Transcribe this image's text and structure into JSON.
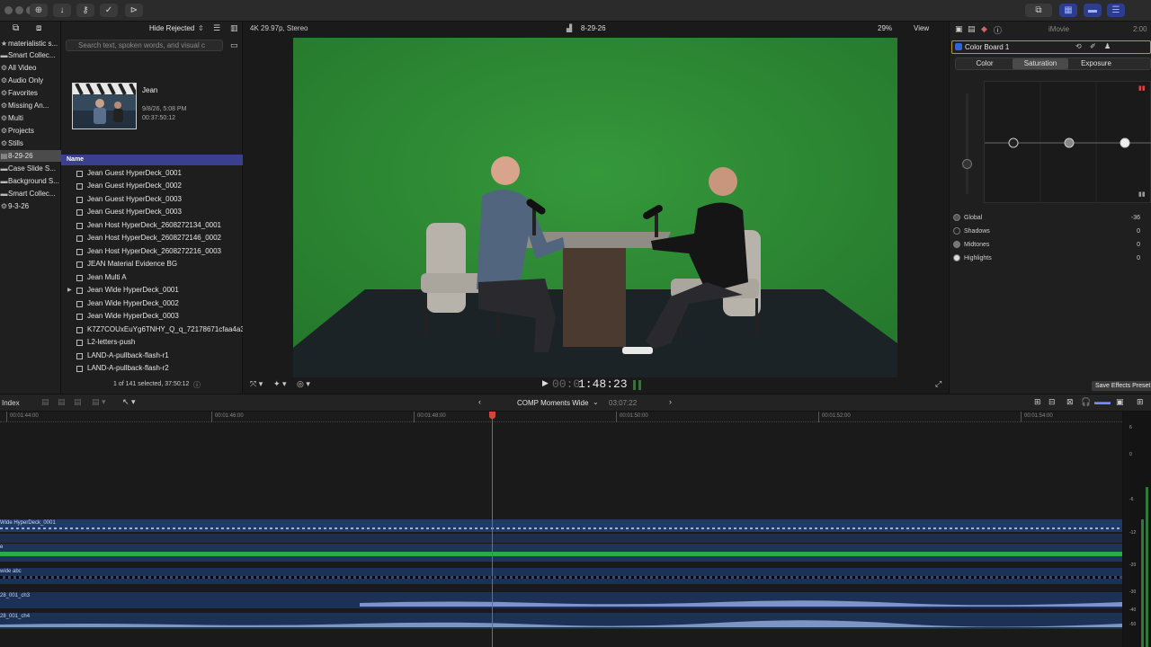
{
  "toolbar": {
    "icons": [
      "import-icon",
      "download-icon",
      "keyword-icon",
      "checkmark-icon",
      "tag-icon"
    ]
  },
  "sidebar": {
    "items": [
      {
        "label": "materialistic s...",
        "icon": "star"
      },
      {
        "label": "Smart Collec...",
        "icon": "folder"
      },
      {
        "label": "All Video",
        "icon": "gear"
      },
      {
        "label": "Audio Only",
        "icon": "gear"
      },
      {
        "label": "Favorites",
        "icon": "gear"
      },
      {
        "label": "Missing An...",
        "icon": "gear"
      },
      {
        "label": "Multi",
        "icon": "gear"
      },
      {
        "label": "Projects",
        "icon": "gear"
      },
      {
        "label": "Stills",
        "icon": "gear"
      },
      {
        "label": "8-29-26",
        "icon": "event",
        "selected": true
      },
      {
        "label": "Case Slide S...",
        "icon": "folder"
      },
      {
        "label": "Background S...",
        "icon": "folder"
      },
      {
        "label": "Smart Collec...",
        "icon": "folder"
      },
      {
        "label": "9-3-26",
        "icon": "event"
      }
    ]
  },
  "browser": {
    "filter": "Hide Rejected",
    "search_placeholder": "Search text, spoken words, and visual c",
    "clip": {
      "name": "Jean",
      "date": "9/8/26, 5:08 PM",
      "duration": "00:37:50:12"
    },
    "list_header": "Name",
    "rows": [
      {
        "name": "Jean Guest HyperDeck_0001"
      },
      {
        "name": "Jean Guest HyperDeck_0002"
      },
      {
        "name": "Jean Guest HyperDeck_0003"
      },
      {
        "name": "Jean Guest HyperDeck_0003"
      },
      {
        "name": "Jean Host HyperDeck_2608272134_0001"
      },
      {
        "name": "Jean Host HyperDeck_2608272146_0002"
      },
      {
        "name": "Jean Host HyperDeck_2608272216_0003"
      },
      {
        "name": "JEAN Material Evidence BG"
      },
      {
        "name": "Jean Multi A"
      },
      {
        "name": "Jean Wide HyperDeck_0001",
        "expand": "▶"
      },
      {
        "name": "Jean Wide HyperDeck_0002"
      },
      {
        "name": "Jean Wide HyperDeck_0003"
      },
      {
        "name": "K7Z7COUxEuYg6TNHY_Q_q_72178671cfaa4a3"
      },
      {
        "name": "L2-letters-push"
      },
      {
        "name": "LAND-A-pullback-flash-r1"
      },
      {
        "name": "LAND-A-pullback-flash-r2"
      }
    ],
    "status": "1 of 141 selected, 37:50:12"
  },
  "viewer": {
    "format": "4K 29.97p, Stereo",
    "title": "8-29-26",
    "zoom": "29%",
    "view_label": "View",
    "timecode_dim": "00:0",
    "timecode": "1:48:23"
  },
  "inspector": {
    "app_label": "iMovie",
    "time_fragment": "2:00",
    "effect_name": "Color Board 1",
    "tabs": [
      "Color",
      "Saturation",
      "Exposure"
    ],
    "active_tab": "Saturation",
    "rows": [
      {
        "label": "Global",
        "value": "-36"
      },
      {
        "label": "Shadows",
        "value": "0"
      },
      {
        "label": "Midtones",
        "value": "0"
      },
      {
        "label": "Highlights",
        "value": "0"
      }
    ],
    "save_button": "Save Effects Preset",
    "puck_levels": [
      0.0,
      0.5,
      1.0
    ]
  },
  "timeline": {
    "index_label": "Index",
    "project_name": "COMP Moments Wide",
    "project_duration": "03:07:22",
    "ruler": [
      "00:01:44:00",
      "00:01:46:00",
      "00:01:48:00",
      "00:01:50:00",
      "00:01:52:00",
      "00:01:54:00"
    ],
    "lanes": [
      {
        "label": "Wide HyperDeck_0001"
      },
      {
        "label": "e"
      },
      {
        "label": "wide abc"
      },
      {
        "label": "28_001_ch3"
      },
      {
        "label": "28_001_ch4"
      }
    ],
    "meter_scale": [
      "6",
      "0",
      "-6",
      "-12",
      "-20",
      "-30",
      "-40",
      "-50"
    ]
  },
  "colors": {
    "accent": "#3a3f8f",
    "greenscreen": "#2d8a34",
    "playhead": "#d0483a",
    "clip_blue": "#1f3a66"
  }
}
